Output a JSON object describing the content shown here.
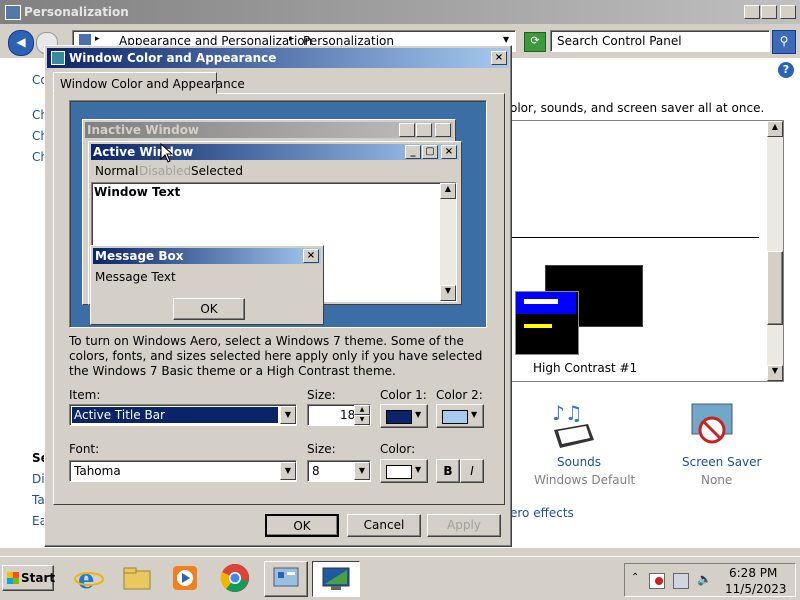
{
  "outer_window": {
    "title": "Personalization",
    "address": {
      "crumb1": "Appearance and Personalization",
      "crumb2": "Personalization"
    },
    "search_placeholder": "Search Control Panel",
    "left_links": [
      "Co",
      "Ch",
      "Ch",
      "Ch"
    ],
    "left_bottom": {
      "heading": "Se",
      "links": [
        "Dis",
        "Ta",
        "Ea"
      ]
    },
    "description": "olor, sounds, and screen saver all at once.",
    "theme_name": "High Contrast #1",
    "sounds": {
      "label": "Sounds",
      "sub": "Windows Default"
    },
    "screensaver": {
      "label": "Screen Saver",
      "sub": "None"
    },
    "aero_link": "ero effects"
  },
  "dialog": {
    "title": "Window Color and Appearance",
    "tab": "Window Color and Appearance",
    "preview": {
      "inactive": "Inactive Window",
      "active": "Active Window",
      "menu": [
        "Normal",
        "Disabled",
        "Selected"
      ],
      "window_text": "Window Text",
      "msgbox_title": "Message Box",
      "msgbox_text": "Message Text",
      "ok": "OK"
    },
    "info": "To turn on Windows Aero, select a Windows 7 theme.  Some of the colors, fonts, and sizes selected here apply only if you have selected the Windows 7 Basic theme or a High Contrast theme.",
    "item_label": "Item:",
    "item_value": "Active Title Bar",
    "size_label": "Size:",
    "size_value": "18",
    "color1_label": "Color 1:",
    "color2_label": "Color 2:",
    "font_label": "Font:",
    "font_value": "Tahoma",
    "font_size_label": "Size:",
    "font_size_value": "8",
    "font_color_label": "Color:",
    "bold": "B",
    "italic": "I",
    "buttons": {
      "ok": "OK",
      "cancel": "Cancel",
      "apply": "Apply"
    },
    "colors": {
      "color1": "#0a246a",
      "color2": "#a6caf0",
      "font_color": "#ffffff"
    }
  },
  "taskbar": {
    "start": "Start",
    "time": "6:28 PM",
    "date": "11/5/2023"
  }
}
